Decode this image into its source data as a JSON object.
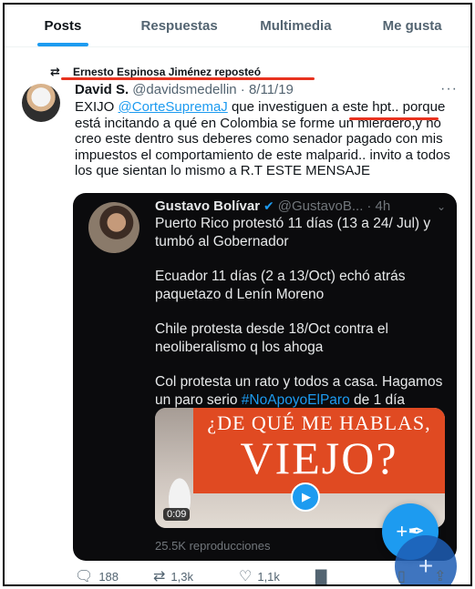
{
  "tabs": [
    {
      "label": "Posts",
      "active": true
    },
    {
      "label": "Respuestas",
      "active": false
    },
    {
      "label": "Multimedia",
      "active": false
    },
    {
      "label": "Me gusta",
      "active": false
    }
  ],
  "repost": {
    "text": "Ernesto Espinosa Jiménez reposteó"
  },
  "tweet": {
    "name": "David S.",
    "handle_date": "@davidsmedellin · 8/11/19",
    "text_before_mention": "EXIJO ",
    "mention": "@CorteSupremaJ",
    "text_after_mention": " que investiguen a este hpt.. porque está incitando a qué en Colombia se forme un mierdero,y no creo este dentro sus deberes como senador pagado con mis impuestos el comportamiento de este malparid.. invito a todos los que sientan lo mismo a R.T ESTE MENSAJE",
    "more": "···"
  },
  "quote": {
    "name": "Gustavo Bolívar",
    "handle": "@GustavoB...",
    "time": "· 4h",
    "paragraphs": [
      "Puerto Rico protestó 11 días (13 a 24/ Jul) y tumbó al Gobernador",
      "Ecuador 11 días (2 a 13/Oct) echó atrás paquetazo d Lenín Moreno",
      "Chile protesta desde 18/Oct contra el neoliberalismo q los ahoga"
    ],
    "last_paragraph_text": "Col protesta un rato y todos a casa. Hagamos un paro serio",
    "hashtag": "#NoApoyoElParo",
    "hashtag_after": " de 1 día",
    "video": {
      "line1": "¿DE QUÉ ME HABLAS,",
      "line2": "VIEJO?",
      "duration": "0:09"
    },
    "views": "25.5K reproducciones"
  },
  "actions": {
    "replies": "188",
    "reposts": "1,3k",
    "likes": "1,1k"
  },
  "colors": {
    "accent": "#1d9bf0",
    "annotation_red": "#e8321f",
    "video_banner": "#e04a22"
  }
}
